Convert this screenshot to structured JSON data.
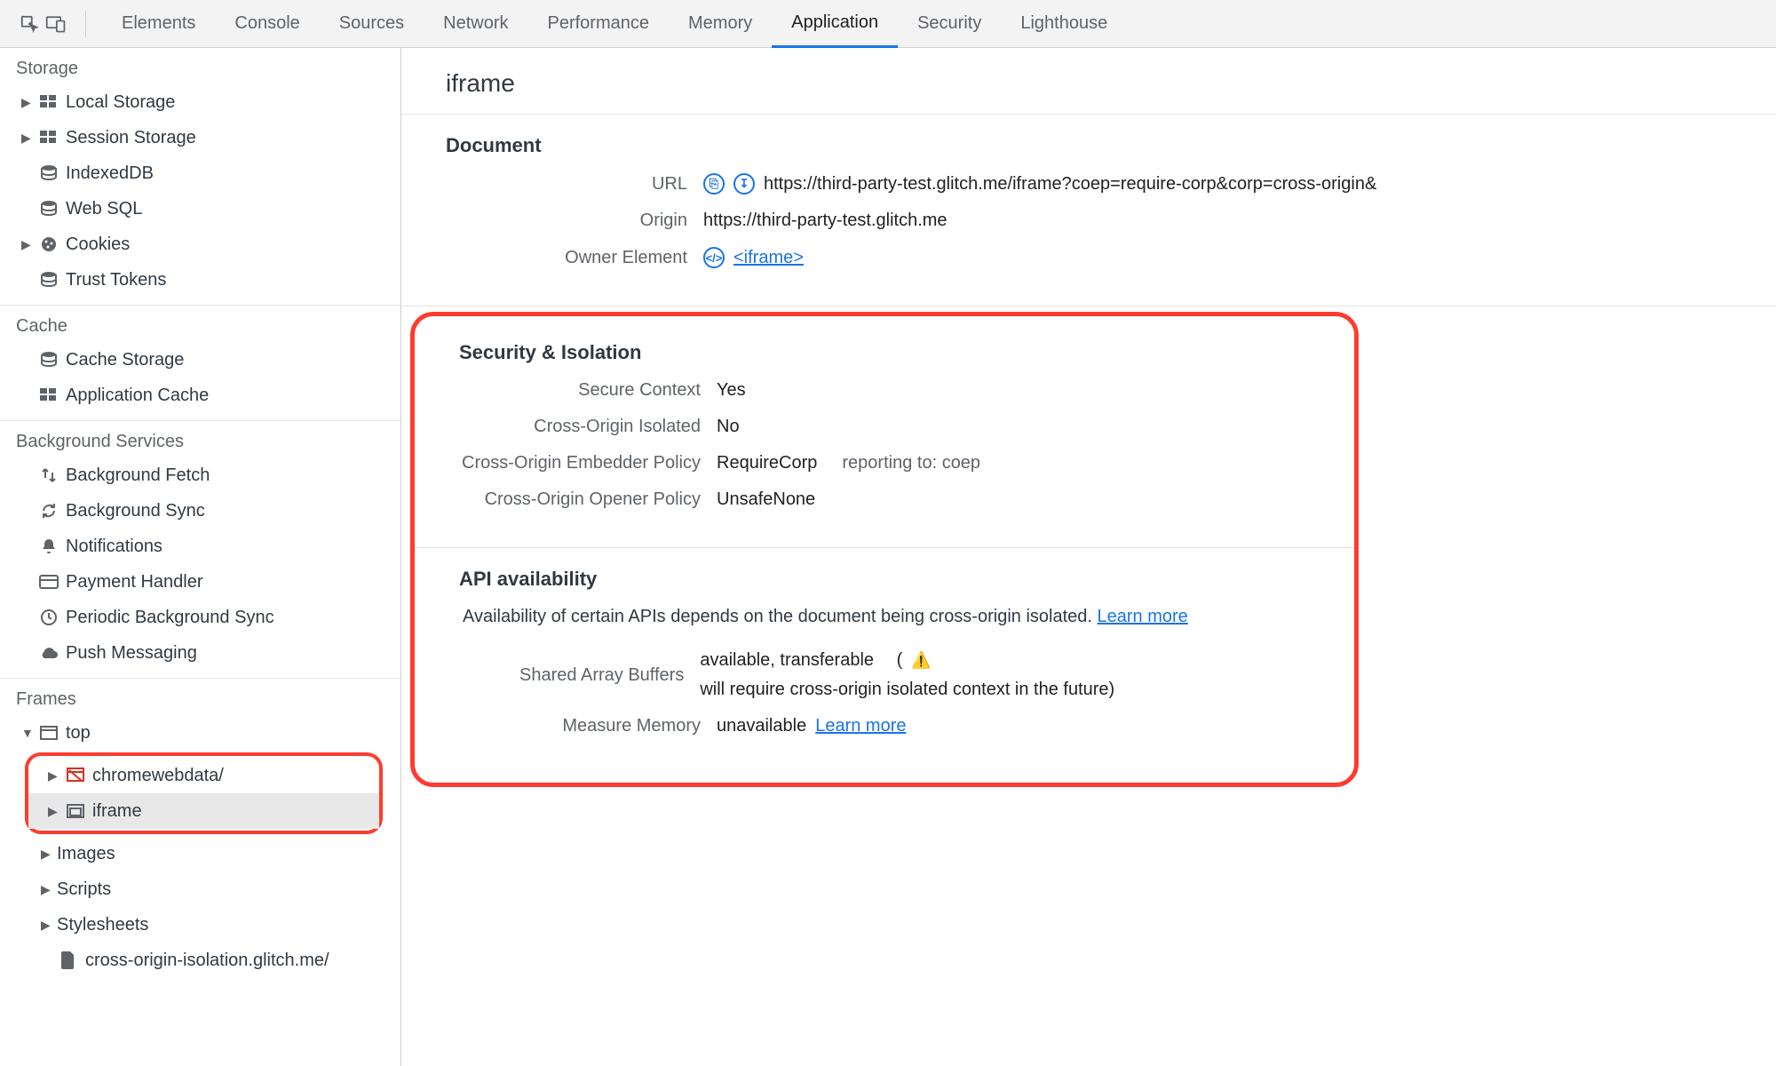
{
  "tabs": {
    "elements": "Elements",
    "console": "Console",
    "sources": "Sources",
    "network": "Network",
    "performance": "Performance",
    "memory": "Memory",
    "application": "Application",
    "security": "Security",
    "lighthouse": "Lighthouse"
  },
  "sidebar": {
    "storage": {
      "heading": "Storage",
      "localStorage": "Local Storage",
      "sessionStorage": "Session Storage",
      "indexedDB": "IndexedDB",
      "webSQL": "Web SQL",
      "cookies": "Cookies",
      "trustTokens": "Trust Tokens"
    },
    "cache": {
      "heading": "Cache",
      "cacheStorage": "Cache Storage",
      "applicationCache": "Application Cache"
    },
    "bg": {
      "heading": "Background Services",
      "backgroundFetch": "Background Fetch",
      "backgroundSync": "Background Sync",
      "notifications": "Notifications",
      "paymentHandler": "Payment Handler",
      "periodicBgSync": "Periodic Background Sync",
      "pushMessaging": "Push Messaging"
    },
    "frames": {
      "heading": "Frames",
      "top": "top",
      "chromewebdata": "chromewebdata/",
      "iframe": "iframe",
      "images": "Images",
      "scripts": "Scripts",
      "stylesheets": "Stylesheets",
      "crossOriginIsolation": "cross-origin-isolation.glitch.me/"
    }
  },
  "main": {
    "title": "iframe",
    "document": {
      "heading": "Document",
      "urlLabel": "URL",
      "urlValue": "https://third-party-test.glitch.me/iframe?coep=require-corp&corp=cross-origin&",
      "originLabel": "Origin",
      "originValue": "https://third-party-test.glitch.me",
      "ownerLabel": "Owner Element",
      "ownerValue": "<iframe>"
    },
    "security": {
      "heading": "Security & Isolation",
      "secureContextLabel": "Secure Context",
      "secureContextValue": "Yes",
      "coiLabel": "Cross-Origin Isolated",
      "coiValue": "No",
      "coepLabel": "Cross-Origin Embedder Policy",
      "coepValue": "RequireCorp",
      "coepReportingLabel": "reporting to:",
      "coepReportingValue": "coep",
      "coopLabel": "Cross-Origin Opener Policy",
      "coopValue": "UnsafeNone"
    },
    "api": {
      "heading": "API availability",
      "desc": "Availability of certain APIs depends on the document being cross-origin isolated.",
      "learnMore": "Learn more",
      "sabLabel": "Shared Array Buffers",
      "sabValue": "available, transferable",
      "sabWarn": "will require cross-origin isolated context in the future)",
      "sabWarnOpen": "(",
      "mmLabel": "Measure Memory",
      "mmValue": "unavailable"
    }
  }
}
